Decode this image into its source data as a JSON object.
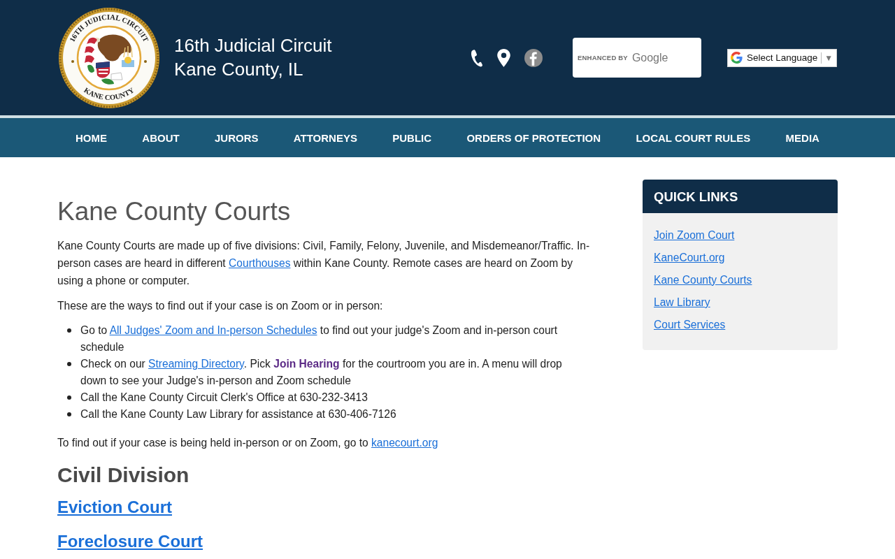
{
  "header": {
    "logo": {
      "top_text": "16TH JUDICIAL CIRCUIT",
      "bottom_text": "KANE COUNTY"
    },
    "site_title": [
      "16th Judicial Circuit",
      "Kane County, IL"
    ],
    "icons": [
      {
        "kind": "phone"
      },
      {
        "kind": "pin"
      },
      {
        "kind": "facebook"
      }
    ],
    "search": {
      "hint_prefix": "ENHANCED BY",
      "hint_brand": "Google"
    },
    "language": {
      "label": "Select Language",
      "caret": "▼"
    }
  },
  "nav": [
    {
      "label": "HOME"
    },
    {
      "label": "ABOUT"
    },
    {
      "label": "JURORS"
    },
    {
      "label": "ATTORNEYS"
    },
    {
      "label": "PUBLIC"
    },
    {
      "label": "ORDERS OF PROTECTION"
    },
    {
      "label": "LOCAL COURT RULES"
    },
    {
      "label": "MEDIA"
    }
  ],
  "main": {
    "title": "Kane County Courts",
    "intro": [
      {
        "kind": "text",
        "text": "Kane County Courts are made up of five divisions: Civil, Family, Felony, Juvenile, and Misdemeanor/Traffic. In-person cases are heard in different "
      },
      {
        "kind": "link",
        "text": "Courthouses"
      },
      {
        "kind": "text",
        "text": " within Kane County. Remote cases are heard on Zoom by using a phone or computer."
      }
    ],
    "ways_intro": "These are the ways to find out if your case is on Zoom or in person:",
    "ways": [
      [
        {
          "kind": "text",
          "text": "Go to "
        },
        {
          "kind": "link",
          "text": "All Judges' Zoom and In-person Schedules"
        },
        {
          "kind": "text",
          "text": " to find out your judge's Zoom and in-person court schedule"
        }
      ],
      [
        {
          "kind": "text",
          "text": "Check on our "
        },
        {
          "kind": "link",
          "text": "Streaming Directory"
        },
        {
          "kind": "text",
          "text": ". Pick **Join Hearing** for the courtroom you are in. A menu will drop down to see your Judge's in-person and Zoom schedule"
        }
      ],
      [
        {
          "kind": "text",
          "text": "Call the Kane County Circuit Clerk's Office at 630-232-3413"
        }
      ],
      [
        {
          "kind": "text",
          "text": "Call the Kane County Law Library for assistance at 630-406-7126"
        }
      ]
    ],
    "closing": [
      {
        "kind": "text",
        "text": "To find out if your case is being held in-person or on Zoom, go to "
      },
      {
        "kind": "link",
        "text": "kanecourt.org"
      }
    ],
    "sections": [
      {
        "kind": "heading",
        "text": "Civil Division"
      },
      {
        "kind": "link",
        "text": "Eviction Court"
      },
      {
        "kind": "link",
        "text": "Foreclosure Court"
      }
    ]
  },
  "sidebar": {
    "title": "QUICK LINKS",
    "links": [
      "Join Zoom Court",
      "KaneCourt.org",
      "Kane County Courts",
      "Law Library",
      "Court Services"
    ]
  }
}
